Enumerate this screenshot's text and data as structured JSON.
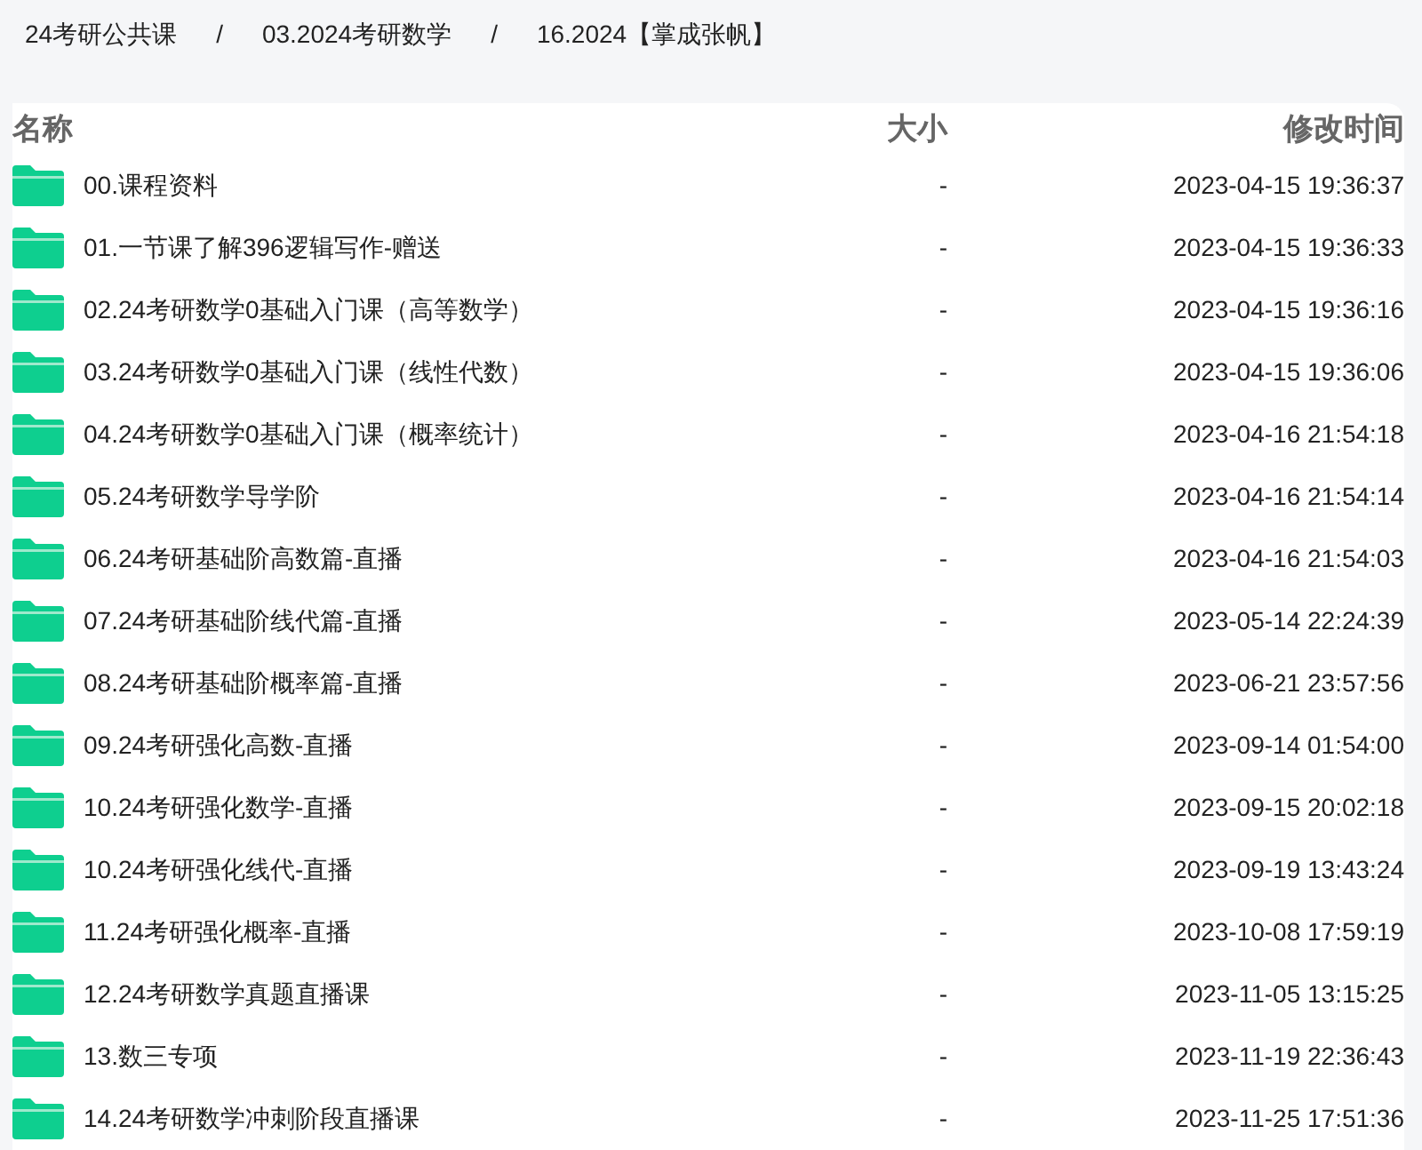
{
  "breadcrumb": [
    {
      "kind": "crumb",
      "label": "24考研公共课"
    },
    {
      "kind": "separator",
      "label": "/"
    },
    {
      "kind": "crumb",
      "label": "03.2024考研数学"
    },
    {
      "kind": "separator",
      "label": "/"
    },
    {
      "kind": "crumb",
      "label": "16.2024【掌成张帆】"
    }
  ],
  "table": {
    "columns": [
      "名称",
      "大小",
      "修改时间"
    ],
    "rows": [
      {
        "name": "00.课程资料",
        "size": "-",
        "modified": "2023-04-15 19:36:37"
      },
      {
        "name": "01.一节课了解396逻辑写作-赠送",
        "size": "-",
        "modified": "2023-04-15 19:36:33"
      },
      {
        "name": "02.24考研数学0基础入门课（高等数学）",
        "size": "-",
        "modified": "2023-04-15 19:36:16"
      },
      {
        "name": "03.24考研数学0基础入门课（线性代数）",
        "size": "-",
        "modified": "2023-04-15 19:36:06"
      },
      {
        "name": "04.24考研数学0基础入门课（概率统计）",
        "size": "-",
        "modified": "2023-04-16 21:54:18"
      },
      {
        "name": "05.24考研数学导学阶",
        "size": "-",
        "modified": "2023-04-16 21:54:14"
      },
      {
        "name": "06.24考研基础阶高数篇-直播",
        "size": "-",
        "modified": "2023-04-16 21:54:03"
      },
      {
        "name": "07.24考研基础阶线代篇-直播",
        "size": "-",
        "modified": "2023-05-14 22:24:39"
      },
      {
        "name": "08.24考研基础阶概率篇-直播",
        "size": "-",
        "modified": "2023-06-21 23:57:56"
      },
      {
        "name": "09.24考研强化高数-直播",
        "size": "-",
        "modified": "2023-09-14 01:54:00"
      },
      {
        "name": "10.24考研强化数学-直播",
        "size": "-",
        "modified": "2023-09-15 20:02:18"
      },
      {
        "name": "10.24考研强化线代-直播",
        "size": "-",
        "modified": "2023-09-19 13:43:24"
      },
      {
        "name": "11.24考研强化概率-直播",
        "size": "-",
        "modified": "2023-10-08 17:59:19"
      },
      {
        "name": "12.24考研数学真题直播课",
        "size": "-",
        "modified": "2023-11-05 13:15:25"
      },
      {
        "name": "13.数三专项",
        "size": "-",
        "modified": "2023-11-19 22:36:43"
      },
      {
        "name": "14.24考研数学冲刺阶段直播课",
        "size": "-",
        "modified": "2023-11-25 17:51:36"
      }
    ]
  }
}
